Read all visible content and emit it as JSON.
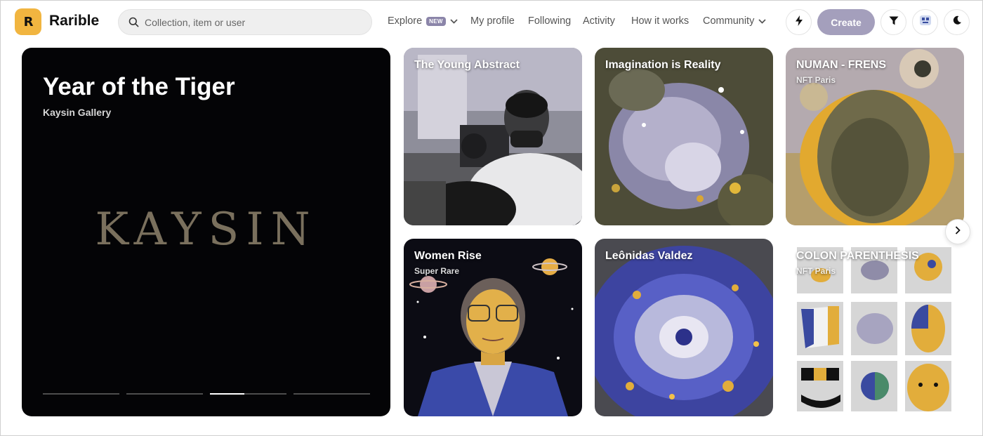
{
  "header": {
    "logo_letter": "R",
    "brand": "Rarible",
    "search_placeholder": "Collection, item or user",
    "nav": [
      {
        "label": "Explore",
        "badge": "NEW",
        "dropdown": true
      },
      {
        "label": "My profile"
      },
      {
        "label": "Following"
      },
      {
        "label": "Activity"
      },
      {
        "label": "How it works"
      },
      {
        "label": "Community",
        "dropdown": true
      }
    ],
    "create_label": "Create",
    "icons": [
      "lightning-icon",
      "filter-funnel-icon",
      "avatar-icon",
      "moon-icon"
    ]
  },
  "hero": {
    "title": "Year of the Tiger",
    "subtitle": "Kaysin Gallery",
    "art_text": "KAYSIN",
    "slides": 4,
    "active_slide": 3,
    "active_progress": 0.45
  },
  "cards": [
    {
      "title": "The Young Abstract",
      "subtitle": ""
    },
    {
      "title": "Imagination is Reality",
      "subtitle": ""
    },
    {
      "title": "NUMAN - FRENS",
      "subtitle": "NFT Paris"
    },
    {
      "title": "Women Rise",
      "subtitle": "Super Rare"
    },
    {
      "title": "Leônidas Valdez",
      "subtitle": ""
    },
    {
      "title": "COLON PARENTHESIS",
      "subtitle": "NFT Paris"
    }
  ],
  "colors": {
    "logo_bg": "#f1b540",
    "create_bg": "#a49fbc",
    "badge_bg": "#8b85a9",
    "hero_bg": "#040406"
  }
}
